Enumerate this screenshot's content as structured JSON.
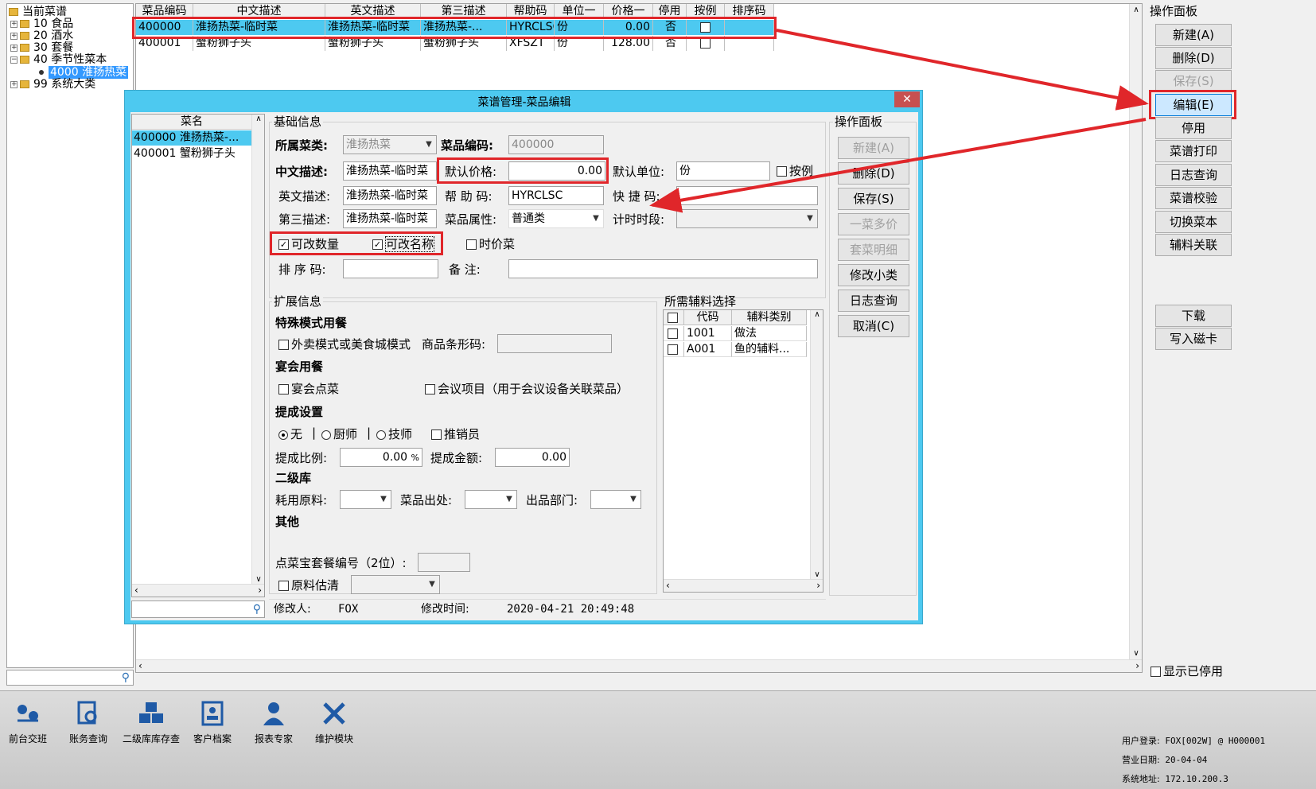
{
  "tree": {
    "root": "当前菜谱",
    "items": [
      {
        "code": "10",
        "name": "食品",
        "expandable": true
      },
      {
        "code": "20",
        "name": "酒水",
        "expandable": true
      },
      {
        "code": "30",
        "name": "套餐",
        "expandable": true
      },
      {
        "code": "40",
        "name": "季节性菜本",
        "expandable": false
      },
      {
        "code": "4000",
        "name": "淮扬热菜",
        "selected": true
      },
      {
        "code": "99",
        "name": "系统大类",
        "expandable": true
      }
    ]
  },
  "grid": {
    "headers": [
      "菜品编码",
      "中文描述",
      "英文描述",
      "第三描述",
      "帮助码",
      "单位一",
      "价格一",
      "停用",
      "按例",
      "排序码"
    ],
    "rows": [
      [
        "400000",
        "淮扬热菜-临时菜",
        "淮扬热菜-临时菜",
        "淮扬热菜-...",
        "HYRCLSC",
        "份",
        "0.00",
        "否",
        "",
        ""
      ],
      [
        "400001",
        "蟹粉狮子头",
        "蟹粉狮子头",
        "蟹粉狮子头",
        "XFSZT",
        "份",
        "128.00",
        "否",
        "",
        ""
      ]
    ]
  },
  "right_panel": {
    "title": "操作面板",
    "buttons": [
      "新建(A)",
      "删除(D)",
      "保存(S)",
      "编辑(E)",
      "停用",
      "菜谱打印",
      "日志查询",
      "菜谱校验",
      "切换菜本",
      "辅料关联",
      "下载",
      "写入磁卡"
    ],
    "show_disabled": "显示已停用"
  },
  "dialog": {
    "title": "菜谱管理-菜品编辑",
    "list_header": "菜名",
    "list_items": [
      "400000 淮扬热菜-...",
      "400001 蟹粉狮子头"
    ],
    "basic": {
      "title": "基础信息",
      "category_label": "所属菜类:",
      "category_value": "淮扬热菜",
      "code_label": "菜品编码:",
      "code_value": "400000",
      "cn_label": "中文描述:",
      "cn_value": "淮扬热菜-临时菜",
      "price_label": "默认价格:",
      "price_value": "0.00",
      "unit_label": "默认单位:",
      "unit_value": "份",
      "by_example": "按例",
      "en_label": "英文描述:",
      "en_value": "淮扬热菜-临时菜",
      "help_label": "帮 助 码:",
      "help_value": "HYRCLSC",
      "quick_label": "快 捷 码:",
      "quick_value": "",
      "third_label": "第三描述:",
      "third_value": "淮扬热菜-临时菜",
      "attr_label": "菜品属性:",
      "attr_value": "普通类",
      "time_label": "计时时段:",
      "time_value": "",
      "chk_qty": "可改数量",
      "chk_name": "可改名称",
      "chk_time": "时价菜",
      "sort_label": "排 序 码:",
      "sort_value": "",
      "note_label": "备   注:",
      "note_value": ""
    },
    "ext": {
      "title": "扩展信息",
      "special": "特殊模式用餐",
      "takeout": "外卖模式或美食城模式",
      "barcode_label": "商品条形码:",
      "barcode_value": "",
      "banquet": "宴会用餐",
      "banquet_order": "宴会点菜",
      "meeting": "会议项目（用于会议设备关联菜品）",
      "commission": "提成设置",
      "radio_none": "无",
      "radio_chef": "厨师",
      "radio_tech": "技师",
      "chk_promoter": "推销员",
      "ratio_label": "提成比例:",
      "ratio_value": "0.00",
      "ratio_unit": "%",
      "amount_label": "提成金额:",
      "amount_value": "0.00",
      "level2": "二级库",
      "material_label": "耗用原料:",
      "source_label": "菜品出处:",
      "dept_label": "出品部门:",
      "other": "其他",
      "dcb_label": "点菜宝套餐编号（2位）:",
      "dcb_value": "",
      "estimate": "原料估清"
    },
    "aux": {
      "title": "所需辅料选择",
      "headers": [
        "代码",
        "辅料类别"
      ],
      "rows": [
        [
          "1001",
          "做法"
        ],
        [
          "A001",
          "鱼的辅料..."
        ]
      ]
    },
    "ops": {
      "title": "操作面板",
      "buttons": [
        "新建(A)",
        "删除(D)",
        "保存(S)",
        "一菜多价",
        "套菜明细",
        "修改小类",
        "日志查询",
        "取消(C)"
      ]
    },
    "footer": {
      "modifier_label": "修改人:",
      "modifier": "FOX",
      "time_label": "修改时间:",
      "time": "2020-04-21 20:49:48"
    }
  },
  "taskbar": {
    "items": [
      "前台交班",
      "账务查询",
      "二级库库存查",
      "客户档案",
      "报表专家",
      "维护模块"
    ],
    "status": {
      "user_label": "用户登录:",
      "user": "FOX[002W] @ H000001",
      "date_label": "营业日期:",
      "date": "20-04-04",
      "addr_label": "系统地址:",
      "addr": "172.10.200.3"
    }
  },
  "colors": {
    "accent": "#4dc9f0",
    "red": "#e0262a",
    "selected": "#3399ff"
  }
}
